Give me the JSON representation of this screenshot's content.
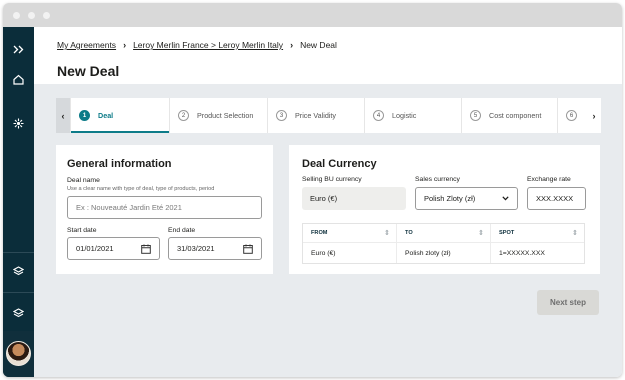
{
  "breadcrumb": {
    "items": [
      "My Agreements",
      "Leroy Merlin France > Leroy Merlin Italy",
      "New Deal"
    ]
  },
  "page": {
    "title": "New Deal"
  },
  "stepper": {
    "steps": [
      {
        "num": "1",
        "label": "Deal"
      },
      {
        "num": "2",
        "label": "Product Selection"
      },
      {
        "num": "3",
        "label": "Price Validity"
      },
      {
        "num": "4",
        "label": "Logistic"
      },
      {
        "num": "5",
        "label": "Cost component"
      },
      {
        "num": "6",
        "label": ""
      }
    ],
    "active_index": 0
  },
  "general": {
    "title": "General information",
    "deal_name_label": "Deal name",
    "deal_name_hint": "Use a clear name with type of deal, type of products, period",
    "deal_name_placeholder": "Ex : Nouveauté Jardin Eté 2021",
    "start_label": "Start date",
    "start_value": "01/01/2021",
    "end_label": "End date",
    "end_value": "31/03/2021"
  },
  "currency": {
    "title": "Deal Currency",
    "selling_label": "Selling BU currency",
    "selling_value": "Euro (€)",
    "sales_label": "Sales currency",
    "sales_value": "Polish Zloty (zł)",
    "rate_label": "Exchange rate",
    "rate_value": "XXX.XXXX",
    "table": {
      "headers": [
        "FROM",
        "TO",
        "SPOT"
      ],
      "rows": [
        [
          "Euro (€)",
          "Polish zloty (zł)",
          "1=XXXXX.XXX"
        ]
      ]
    }
  },
  "actions": {
    "next_label": "Next step"
  },
  "colors": {
    "sidebar": "#0b2d3a",
    "accent": "#0c7b88",
    "background": "#e8ebee"
  }
}
